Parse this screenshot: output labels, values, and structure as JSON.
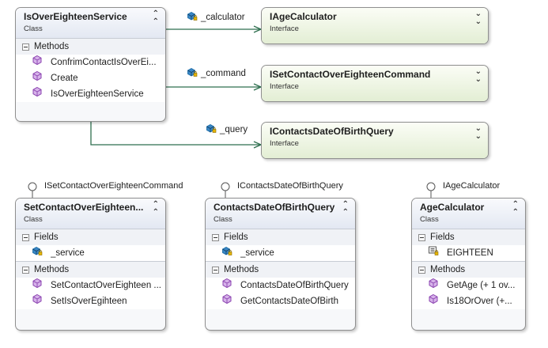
{
  "diagram": {
    "classes": [
      {
        "id": "isover",
        "name": "IsOverEighteenService",
        "kind": "Class",
        "sections": [
          {
            "title": "Methods",
            "members": [
              {
                "icon": "method-icon",
                "text": "ConfrimContactIsOverEi..."
              },
              {
                "icon": "method-icon",
                "text": "Create"
              },
              {
                "icon": "method-icon",
                "text": "IsOverEighteenService"
              }
            ]
          }
        ]
      },
      {
        "id": "iage",
        "name": "IAgeCalculator",
        "kind": "Interface",
        "sections": []
      },
      {
        "id": "iset",
        "name": "ISetContactOverEighteenCommand",
        "kind": "Interface",
        "sections": []
      },
      {
        "id": "iquery",
        "name": "IContactsDateOfBirthQuery",
        "kind": "Interface",
        "sections": []
      },
      {
        "id": "setcmd",
        "name": "SetContactOverEighteen...",
        "kind": "Class",
        "sections": [
          {
            "title": "Fields",
            "members": [
              {
                "icon": "field-icon",
                "text": "_service"
              }
            ]
          },
          {
            "title": "Methods",
            "members": [
              {
                "icon": "method-icon",
                "text": "SetContactOverEighteen ..."
              },
              {
                "icon": "method-icon",
                "text": "SetIsOverEgihteen"
              }
            ]
          }
        ]
      },
      {
        "id": "dobquery",
        "name": "ContactsDateOfBirthQuery",
        "kind": "Class",
        "sections": [
          {
            "title": "Fields",
            "members": [
              {
                "icon": "field-icon",
                "text": "_service"
              }
            ]
          },
          {
            "title": "Methods",
            "members": [
              {
                "icon": "method-icon",
                "text": "ContactsDateOfBirthQuery"
              },
              {
                "icon": "method-icon",
                "text": "GetContactsDateOfBirth"
              }
            ]
          }
        ]
      },
      {
        "id": "agecalc",
        "name": "AgeCalculator",
        "kind": "Class",
        "sections": [
          {
            "title": "Fields",
            "members": [
              {
                "icon": "constant-icon",
                "text": "EIGHTEEN"
              }
            ]
          },
          {
            "title": "Methods",
            "members": [
              {
                "icon": "method-icon",
                "text": "GetAge (+ 1 ov..."
              },
              {
                "icon": "method-icon",
                "text": "Is18OrOver (+..."
              }
            ]
          }
        ]
      }
    ],
    "associations": [
      {
        "from": "isover",
        "to": "iage",
        "label": "_calculator"
      },
      {
        "from": "isover",
        "to": "iset",
        "label": "_command"
      },
      {
        "from": "isover",
        "to": "iquery",
        "label": "_query"
      }
    ],
    "implements": [
      {
        "cls": "setcmd",
        "label": "ISetContactOverEighteenCommand"
      },
      {
        "cls": "dobquery",
        "label": "IContactsDateOfBirthQuery"
      },
      {
        "cls": "agecalc",
        "label": "IAgeCalculator"
      }
    ]
  },
  "colors": {
    "wire": "#2f6f4f",
    "method": "#8b44b0",
    "field": "#1f6fa8",
    "constant": "#555555"
  }
}
